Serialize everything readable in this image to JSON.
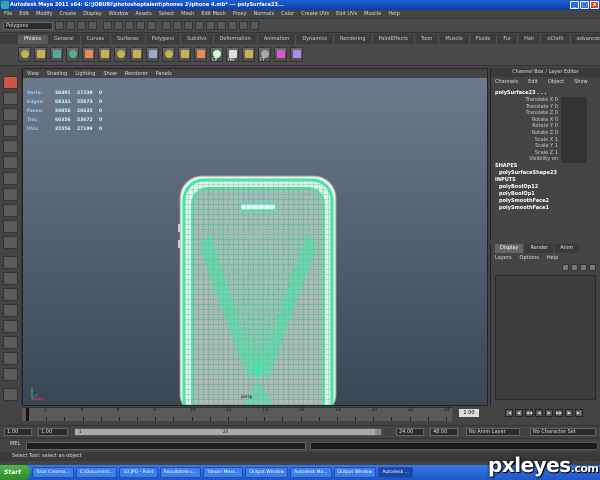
{
  "window": {
    "title": "Autodesk Maya 2011 x64: G:\\JOBURI\\photoshoptalent\\phones 2\\iphone 4.mb*    ---    polySurface23...",
    "minimize": "_",
    "maximize": "□",
    "close": "x"
  },
  "menubar": [
    "File",
    "Edit",
    "Modify",
    "Create",
    "Display",
    "Window",
    "Assets",
    "Select",
    "Mesh",
    "Edit Mesh",
    "Proxy",
    "Normals",
    "Color",
    "Create UVs",
    "Edit UVs",
    "Muscle",
    "Help"
  ],
  "statusline": {
    "mode": "Polygons"
  },
  "shelf": {
    "tabs": [
      "Phisics",
      "General",
      "Curves",
      "Surfaces",
      "Polygons",
      "Subdivs",
      "Deformation",
      "Animation",
      "Dynamics",
      "Rendering",
      "PaintEffects",
      "Toon",
      "Muscle",
      "Fluids",
      "Fur",
      "Hair",
      "nCloth",
      "advancedSkeleton"
    ],
    "active_tab": "Phisics",
    "icon_labels": [
      "",
      "",
      "",
      "",
      "",
      "",
      "",
      "",
      "",
      "",
      "",
      "",
      "CP",
      "Hlo",
      "",
      "FT",
      "",
      ""
    ]
  },
  "viewport": {
    "menu": [
      "View",
      "Shading",
      "Lighting",
      "Show",
      "Renderer",
      "Panels"
    ],
    "hud": [
      {
        "label": "Verts:",
        "a": "30491",
        "b": "27239",
        "c": "0"
      },
      {
        "label": "Edges:",
        "a": "68341",
        "b": "55873",
        "c": "0"
      },
      {
        "label": "Faces:",
        "a": "29856",
        "b": "28635",
        "c": "0"
      },
      {
        "label": "Tris:",
        "a": "60356",
        "b": "53672",
        "c": "0"
      },
      {
        "label": "UVs:",
        "a": "35556",
        "b": "27199",
        "c": "0"
      }
    ],
    "camera": "persp",
    "wire_color": "#3fe8a6"
  },
  "channelbox": {
    "title": "Channel Box / Layer Editor",
    "menu": [
      "Channels",
      "Edit",
      "Object",
      "Show"
    ],
    "object": "polySurface23 . . .",
    "attributes": [
      "Translate X 0",
      "Translate Y 0",
      "Translate Z 0",
      "Rotate X 0",
      "Rotate Y 0",
      "Rotate Z 0",
      "Scale X 1",
      "Scale Y 1",
      "Scale Z 1",
      "Visibility on"
    ],
    "shapes_header": "SHAPES",
    "shape_node": "polySurfaceShape23",
    "inputs_header": "INPUTS",
    "inputs": [
      "polyBoolOp12",
      "polyBoolOp1",
      "polySmoothFace2",
      "polySmoothFace1"
    ]
  },
  "layereditor": {
    "tabs": [
      "Display",
      "Render",
      "Anim"
    ],
    "active_tab": "Display",
    "menu": [
      "Layers",
      "Options",
      "Help"
    ]
  },
  "timeslider": {
    "ticks": [
      "2",
      "4",
      "6",
      "8",
      "10",
      "12",
      "14",
      "16",
      "18",
      "20",
      "22",
      "24"
    ],
    "current": "1.00",
    "playback": [
      "|◀",
      "◀|",
      "◀◀",
      "◀",
      "▶",
      "▶▶",
      "|▶",
      "▶|"
    ]
  },
  "rangeslider": {
    "start": "1.00",
    "start2": "1.00",
    "inner_start": "1",
    "inner_end": "24",
    "end": "24.00",
    "end2": "48.00",
    "anim_layer": "No Anim Layer",
    "character": "No Character Set"
  },
  "cmdline": {
    "label": "MEL"
  },
  "helpline": {
    "text": "Select Tool: select an object"
  },
  "taskbar": {
    "start": "Start",
    "items": [
      "Total Comma...",
      "C:\\Document...",
      "10.JPG - Paint",
      "Rezultatele c...",
      "Yahoo! Mess...",
      "Output Window",
      "Autodesk Ma...",
      "Output Window",
      "Autodesk ..."
    ],
    "active": 8
  },
  "watermark": {
    "main": "pxleyes",
    "suffix": ".com"
  }
}
